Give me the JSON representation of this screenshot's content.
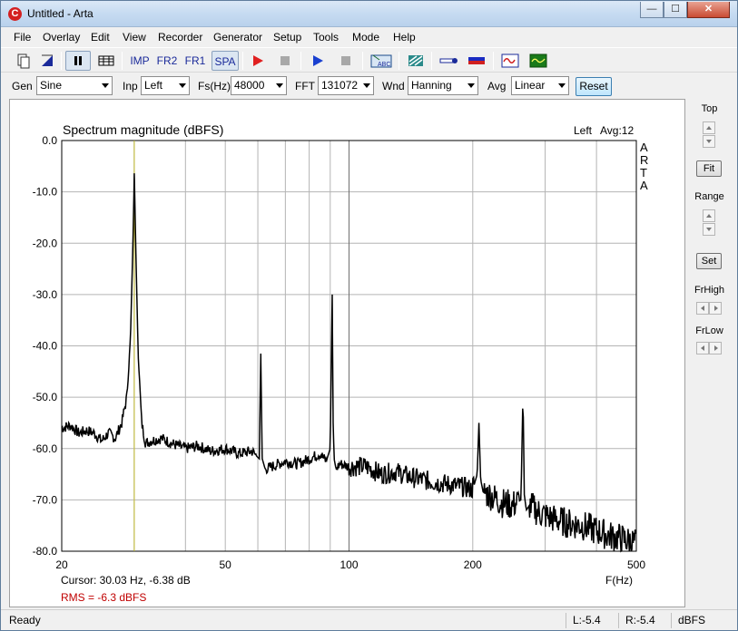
{
  "window": {
    "title": "Untitled - Arta",
    "minimize": "—",
    "maximize": "☐",
    "close": "✕"
  },
  "menu": [
    "File",
    "Overlay",
    "Edit",
    "View",
    "Recorder",
    "Generator",
    "Setup",
    "Tools",
    "Mode",
    "Help"
  ],
  "toolbar": {
    "imp": "IMP",
    "fr2": "FR2",
    "fr1": "FR1",
    "spa": "SPA",
    "abc": "ABC"
  },
  "controls": {
    "gen_label": "Gen",
    "gen_value": "Sine",
    "inp_label": "Inp",
    "inp_value": "Left",
    "fs_label": "Fs(Hz)",
    "fs_value": "48000",
    "fft_label": "FFT",
    "fft_value": "131072",
    "wnd_label": "Wnd",
    "wnd_value": "Hanning",
    "avg_label": "Avg",
    "avg_value": "Linear",
    "reset_label": "Reset"
  },
  "side": {
    "top_label": "Top",
    "fit_label": "Fit",
    "range_label": "Range",
    "set_label": "Set",
    "frhigh_label": "FrHigh",
    "frlow_label": "FrLow"
  },
  "plot": {
    "title": "Spectrum magnitude (dBFS)",
    "channel": "Left",
    "avg": "Avg:12",
    "watermark": [
      "A",
      "R",
      "T",
      "A"
    ],
    "cursor_text": "Cursor: 30.03 Hz, -6.38 dB",
    "rms_text": "RMS =   -6.3 dBFS",
    "colors": {
      "trace": "#000000",
      "cursor": "#c8c030",
      "rms": "#c00000",
      "grid": "#b4b4b4"
    }
  },
  "chart_data": {
    "type": "line",
    "title": "Spectrum magnitude (dBFS)",
    "xlabel": "F(Hz)",
    "ylabel": "",
    "x_scale": "log",
    "xlim": [
      20,
      500
    ],
    "ylim": [
      -80,
      0
    ],
    "x_ticks": [
      20,
      50,
      100,
      200,
      500
    ],
    "x_tick_labels": [
      "20",
      "50",
      "100",
      "200",
      "500"
    ],
    "y_ticks": [
      0,
      -10,
      -20,
      -30,
      -40,
      -50,
      -60,
      -70,
      -80
    ],
    "y_tick_labels": [
      "0.0",
      "-10.0",
      "-20.0",
      "-30.0",
      "-40.0",
      "-50.0",
      "-60.0",
      "-70.0",
      "-80.0"
    ],
    "cursor_x": 30.03,
    "series": [
      {
        "x": [
          20,
          21,
          22,
          23,
          24,
          25,
          26,
          27,
          28,
          28.8,
          29.4,
          29.8,
          30.03,
          30.3,
          30.7,
          31.3,
          32,
          33,
          35,
          37,
          40,
          43,
          46,
          50,
          54,
          58,
          60.5,
          61,
          61.5,
          62.5,
          65,
          70,
          75,
          80,
          85,
          88,
          90,
          91,
          91.5,
          92,
          93,
          95,
          100,
          110,
          120,
          130,
          140,
          150,
          160,
          175,
          190,
          200,
          205,
          207,
          209,
          212,
          220,
          235,
          250,
          262,
          265,
          267,
          270,
          275,
          290,
          310,
          340,
          370,
          400,
          430,
          460,
          500
        ],
        "y": [
          -56,
          -55.5,
          -57,
          -56.5,
          -57,
          -58.5,
          -57,
          -58,
          -55,
          -50,
          -38,
          -20,
          -6.4,
          -22,
          -42,
          -55,
          -59,
          -58.5,
          -58,
          -59,
          -60,
          -59.5,
          -60.5,
          -60,
          -61,
          -60.5,
          -62,
          -41.5,
          -62,
          -64,
          -63.5,
          -62.5,
          -63,
          -62,
          -61,
          -62.5,
          -60,
          -30,
          -55,
          -62,
          -64,
          -63,
          -63.5,
          -63.5,
          -65,
          -64.5,
          -65.5,
          -66,
          -66.5,
          -67,
          -67.5,
          -68,
          -65,
          -55,
          -66,
          -68.5,
          -69,
          -70.5,
          -71,
          -70,
          -49,
          -69,
          -72,
          -71,
          -72.5,
          -73.5,
          -74.5,
          -75,
          -76,
          -77,
          -77.5,
          -78.5
        ]
      }
    ]
  },
  "status": {
    "ready": "Ready",
    "l": "L:-5.4",
    "r": "R:-5.4",
    "unit": "dBFS"
  }
}
